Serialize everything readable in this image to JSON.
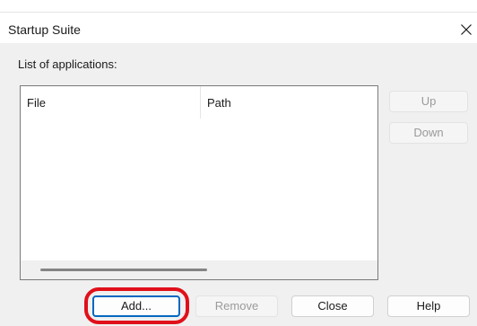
{
  "window": {
    "title": "Startup Suite",
    "close_glyph": "✕"
  },
  "list": {
    "label": "List of applications:",
    "columns": [
      {
        "label": "File"
      },
      {
        "label": "Path"
      }
    ],
    "rows": []
  },
  "side_buttons": {
    "up_label": "Up",
    "down_label": "Down"
  },
  "bottom_buttons": {
    "add_label": "Add...",
    "remove_label": "Remove",
    "close_label": "Close",
    "help_label": "Help"
  },
  "colors": {
    "highlight_ring": "#e0101a",
    "default_button_border": "#0067c0",
    "dialog_background": "#f0f0f0"
  },
  "icons": {
    "close": "close-icon"
  }
}
